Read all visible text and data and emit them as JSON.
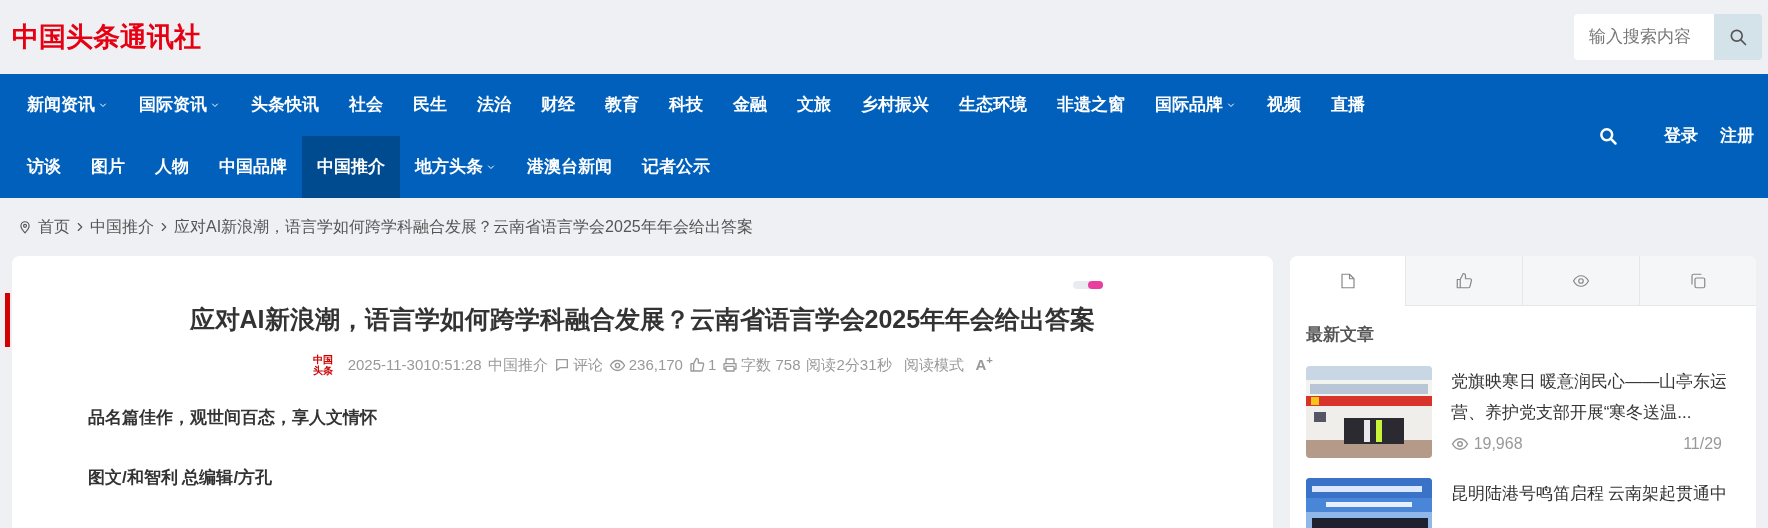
{
  "header": {
    "site_name": "中国头条通讯社",
    "search": {
      "placeholder": "输入搜索内容"
    }
  },
  "nav": {
    "items": [
      {
        "label": "新闻资讯",
        "dropdown": true,
        "selected": false
      },
      {
        "label": "国际资讯",
        "dropdown": true,
        "selected": false
      },
      {
        "label": "头条快讯",
        "dropdown": false,
        "selected": false
      },
      {
        "label": "社会",
        "dropdown": false,
        "selected": false
      },
      {
        "label": "民生",
        "dropdown": false,
        "selected": false
      },
      {
        "label": "法治",
        "dropdown": false,
        "selected": false
      },
      {
        "label": "财经",
        "dropdown": false,
        "selected": false
      },
      {
        "label": "教育",
        "dropdown": false,
        "selected": false
      },
      {
        "label": "科技",
        "dropdown": false,
        "selected": false
      },
      {
        "label": "金融",
        "dropdown": false,
        "selected": false
      },
      {
        "label": "文旅",
        "dropdown": false,
        "selected": false
      },
      {
        "label": "乡村振兴",
        "dropdown": false,
        "selected": false
      },
      {
        "label": "生态环境",
        "dropdown": false,
        "selected": false
      },
      {
        "label": "非遗之窗",
        "dropdown": false,
        "selected": false
      },
      {
        "label": "国际品牌",
        "dropdown": true,
        "selected": false
      },
      {
        "label": "视频",
        "dropdown": false,
        "selected": false
      },
      {
        "label": "直播",
        "dropdown": false,
        "selected": false
      },
      {
        "label": "访谈",
        "dropdown": false,
        "selected": false
      },
      {
        "label": "图片",
        "dropdown": false,
        "selected": false
      },
      {
        "label": "人物",
        "dropdown": false,
        "selected": false
      },
      {
        "label": "中国品牌",
        "dropdown": false,
        "selected": false
      },
      {
        "label": "中国推介",
        "dropdown": false,
        "selected": true
      },
      {
        "label": "地方头条",
        "dropdown": true,
        "selected": false
      },
      {
        "label": "港澳台新闻",
        "dropdown": false,
        "selected": false
      },
      {
        "label": "记者公示",
        "dropdown": false,
        "selected": false
      }
    ],
    "login": "登录",
    "register": "注册"
  },
  "breadcrumb": [
    "首页",
    "中国推介",
    "应对AI新浪潮，语言学如何跨学科融合发展？云南省语言学会2025年年会给出答案"
  ],
  "article": {
    "progress": {
      "level": 0.5
    },
    "title": "应对AI新浪潮，语言学如何跨学科融合发展？云南省语言学会2025年年会给出答案",
    "meta": {
      "logo_text": "中国头条",
      "datetime": "2025-11-3010:51:28",
      "category": "中国推介",
      "comments": "评论",
      "views": "236,170",
      "likes": "1",
      "word_count": "字数 758",
      "read_time": "阅读2分31秒",
      "reading_mode": "阅读模式",
      "font_size": "A$^{+}$"
    },
    "paragraphs": [
      "品名篇佳作，观世间百态，享人文情怀",
      "图文/和智利 总编辑/方孔"
    ]
  },
  "sidebar": {
    "tabs": [
      {
        "kind": "file",
        "selected": true
      },
      {
        "kind": "like",
        "selected": false
      },
      {
        "kind": "eye",
        "selected": false
      },
      {
        "kind": "copy",
        "selected": false
      }
    ],
    "section_title": "最新文章",
    "articles": [
      {
        "title": "党旗映寒日 暖意润民心——山亭东运营、养护党支部开展“寒冬送温...",
        "views": "19,968",
        "date": "11/29"
      },
      {
        "title": "昆明陆港号鸣笛启程 云南架起贯通中"
      }
    ]
  }
}
